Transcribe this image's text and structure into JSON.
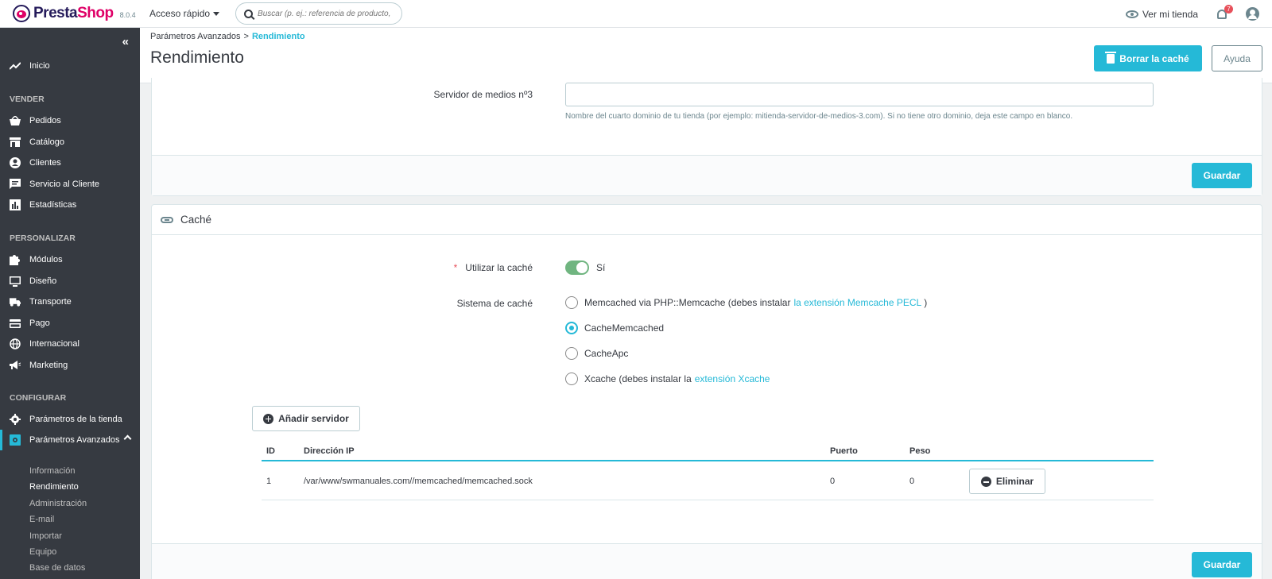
{
  "header": {
    "logo_left": "Presta",
    "logo_right": "Shop",
    "version": "8.0.4",
    "quick_access": "Acceso rápido",
    "search_placeholder": "Buscar (p. ej.: referencia de producto,",
    "view_store": "Ver mi tienda",
    "notifications_count": "7"
  },
  "sidebar": {
    "collapse": "«",
    "home": "Inicio",
    "sections": {
      "sell": "VENDER",
      "customize": "PERSONALIZAR",
      "configure": "CONFIGURAR"
    },
    "sell_items": [
      "Pedidos",
      "Catálogo",
      "Clientes",
      "Servicio al Cliente",
      "Estadísticas"
    ],
    "customize_items": [
      "Módulos",
      "Diseño",
      "Transporte",
      "Pago",
      "Internacional",
      "Marketing"
    ],
    "configure_items": [
      "Parámetros de la tienda",
      "Parámetros Avanzados"
    ],
    "sub_items": [
      "Información",
      "Rendimiento",
      "Administración",
      "E-mail",
      "Importar",
      "Equipo",
      "Base de datos"
    ]
  },
  "page": {
    "breadcrumb_parent": "Parámetros Avanzados",
    "breadcrumb_sep": ">",
    "breadcrumb_current": "Rendimiento",
    "title": "Rendimiento",
    "clear_cache": "Borrar la caché",
    "help": "Ayuda"
  },
  "media_panel": {
    "label": "Servidor de medios nº3",
    "value": "",
    "help": "Nombre del cuarto dominio de tu tienda (por ejemplo: mitienda-servidor-de-medios-3.com). Si no tiene otro dominio, deja este campo en blanco.",
    "save": "Guardar"
  },
  "cache_panel": {
    "title": "Caché",
    "use_cache_label": "Utilizar la caché",
    "required_mark": "*",
    "use_cache_value": "Sí",
    "system_label": "Sistema de caché",
    "options": [
      {
        "text": "Memcached via PHP::Memcache (debes instalar",
        "link": "la extensión Memcache PECL",
        "after": ")"
      },
      {
        "text": "CacheMemcached",
        "link": "",
        "after": ""
      },
      {
        "text": "CacheApc",
        "link": "",
        "after": ""
      },
      {
        "text": "Xcache (debes instalar la",
        "link": "extensión Xcache",
        "after": ""
      }
    ],
    "selected_option": 1,
    "add_server": "Añadir servidor",
    "table": {
      "headers": [
        "ID",
        "Dirección IP",
        "Puerto",
        "Peso"
      ],
      "rows": [
        {
          "id": "1",
          "ip": "/var/www/swmanuales.com//memcached/memcached.sock",
          "port": "0",
          "weight": "0",
          "action": "Eliminar"
        }
      ]
    },
    "save": "Guardar"
  },
  "colors": {
    "primary": "#25b9d7",
    "sidebar": "#363a41",
    "toggle_on": "#70b580"
  }
}
